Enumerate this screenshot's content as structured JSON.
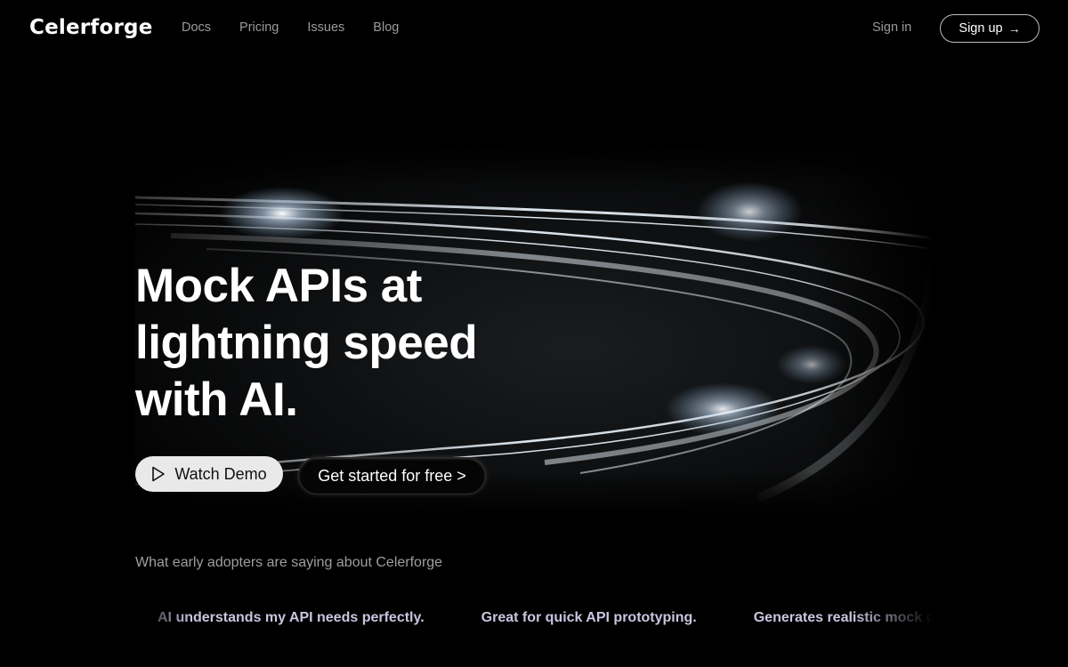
{
  "nav": {
    "logo": "Celerforge",
    "links": [
      "Docs",
      "Pricing",
      "Issues",
      "Blog"
    ],
    "sign_in": "Sign in",
    "sign_up": "Sign up",
    "sign_up_icon": "→"
  },
  "hero": {
    "headline_lines": [
      "Mock APIs at",
      "lightning speed",
      "with AI."
    ],
    "watch_demo": "Watch Demo",
    "get_started": "Get started for free >",
    "image_description": "glowing metallic light-speed ring"
  },
  "testimonials": {
    "heading": "What early adopters are saying about Celerforge",
    "items": [
      "AI understands my API needs perfectly.",
      "Great for quick API prototyping.",
      "Generates realistic mock data"
    ]
  },
  "colors": {
    "background": "#000000",
    "nav_link": "#9a9a9a",
    "demo_button_bg": "#e9e9e9",
    "testimonial_text": "#c8c6e0"
  }
}
